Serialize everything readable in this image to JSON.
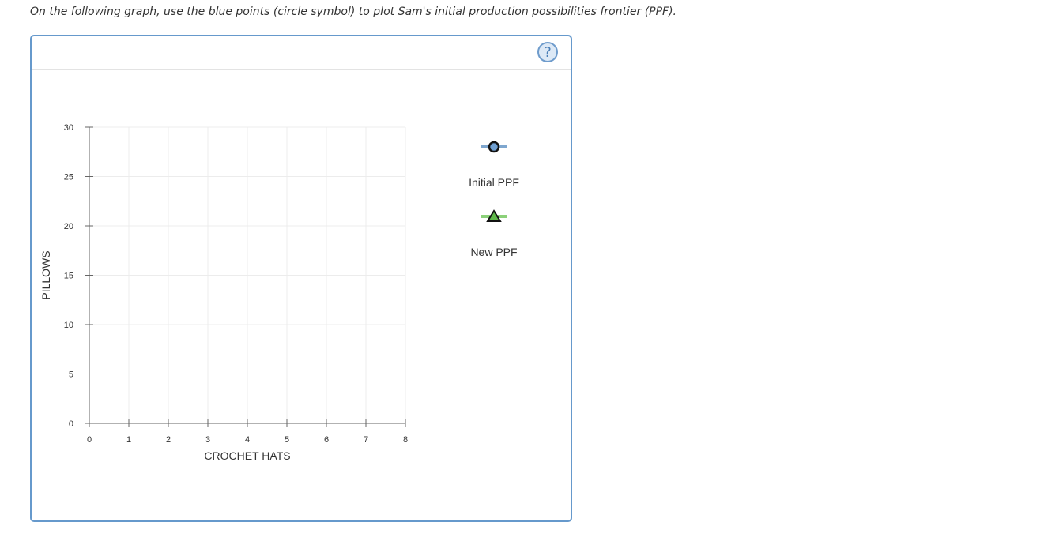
{
  "instruction": "On the following graph, use the blue points (circle symbol) to plot Sam's initial production possibilities frontier (PPF).",
  "help_button": {
    "label": "?",
    "icon": "question-icon"
  },
  "chart_data": {
    "type": "scatter",
    "title": "",
    "xlabel": "CROCHET HATS",
    "ylabel": "PILLOWS",
    "xlim": [
      0,
      8
    ],
    "ylim": [
      0,
      30
    ],
    "xticks": [
      0,
      1,
      2,
      3,
      4,
      5,
      6,
      7,
      8
    ],
    "yticks": [
      0,
      5,
      10,
      15,
      20,
      25,
      30
    ],
    "grid": true,
    "legend_position": "right",
    "series": [
      {
        "name": "Initial PPF",
        "marker": "circle",
        "line_color": "#7fa7cf",
        "marker_fill": "#6f9fd1",
        "values": []
      },
      {
        "name": "New PPF",
        "marker": "triangle",
        "line_color": "#8cd17a",
        "marker_fill": "#5fb84a",
        "values": []
      }
    ]
  }
}
